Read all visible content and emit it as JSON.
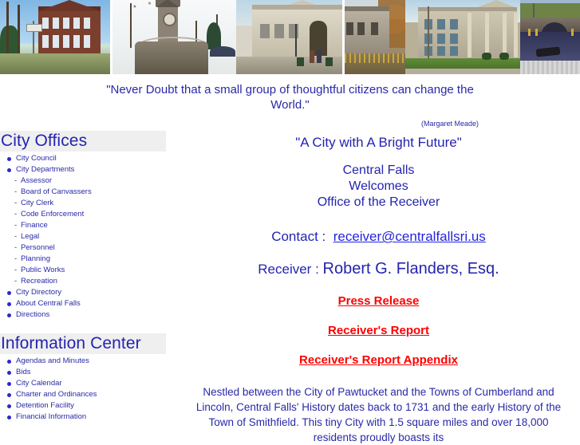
{
  "banner": {
    "alt_labels": [
      "city-hall-brick-building-photo",
      "stone-clock-tower-photo",
      "beige-library-building-photo",
      "stone-building-autumn-foliage-photo",
      "limestone-school-building-photo",
      "stone-arch-bridge-river-photo"
    ]
  },
  "quote": {
    "text": "\"Never Doubt that a small group of thoughtful citizens can change the World.\"",
    "attribution": "(Margaret Meade)"
  },
  "sidebar": {
    "sections": [
      {
        "heading": "City Offices",
        "items": [
          {
            "label": "City Council",
            "style": "bullet"
          },
          {
            "label": "City Departments",
            "style": "bullet"
          },
          {
            "label": "Assessor",
            "style": "dash"
          },
          {
            "label": "Board of Canvassers",
            "style": "dash"
          },
          {
            "label": "City Clerk",
            "style": "dash"
          },
          {
            "label": "Code Enforcement",
            "style": "dash"
          },
          {
            "label": "Finance",
            "style": "dash"
          },
          {
            "label": "Legal",
            "style": "dash"
          },
          {
            "label": "Personnel",
            "style": "dash"
          },
          {
            "label": "Planning",
            "style": "dash"
          },
          {
            "label": "Public Works",
            "style": "dash"
          },
          {
            "label": "Recreation",
            "style": "dash"
          },
          {
            "label": "City Directory",
            "style": "bullet"
          },
          {
            "label": "About Central Falls",
            "style": "bullet"
          },
          {
            "label": "Directions",
            "style": "bullet"
          }
        ]
      },
      {
        "heading": "Information Center",
        "items": [
          {
            "label": "Agendas and Minutes",
            "style": "bullet"
          },
          {
            "label": "Bids",
            "style": "bullet"
          },
          {
            "label": "City Calendar",
            "style": "bullet"
          },
          {
            "label": "Charter and Ordinances",
            "style": "bullet"
          },
          {
            "label": "Detention Facility",
            "style": "bullet"
          },
          {
            "label": "Financial Information",
            "style": "bullet"
          }
        ]
      }
    ]
  },
  "main": {
    "slogan": "\"A City with A Bright Future\"",
    "welcome_line1": "Central Falls",
    "welcome_line2": "Welcomes",
    "welcome_line3": "Office of the Receiver",
    "contact_label": "Contact :",
    "contact_email": "receiver@centralfallsri.us",
    "receiver_label": "Receiver :",
    "receiver_name": "Robert G. Flanders, Esq.",
    "links": [
      "Press Release",
      "Receiver's Report",
      "Receiver's Report Appendix"
    ],
    "history_paragraph": "Nestled between the City of Pawtucket and the Towns of Cumberland and Lincoln, Central  Falls' History dates back to 1731 and the early History of the Town of Smithfield. This tiny City with 1.5 square miles and over 18,000 residents proudly boasts its"
  },
  "colors": {
    "text_blue": "#2929a8",
    "heading_blue": "#2424b0",
    "link_red": "#ff0000",
    "heading_band": "#efefef",
    "page_background": "#ffffff"
  }
}
